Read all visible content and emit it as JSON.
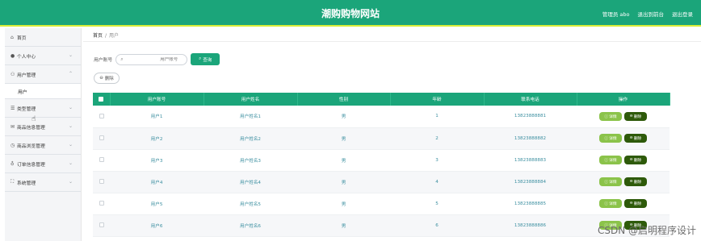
{
  "header": {
    "title": "潮购购物网站",
    "links": [
      "管理员 abo",
      "退出到前台",
      "退出登录"
    ]
  },
  "sidebar": {
    "items": [
      {
        "label": "首页",
        "icon": "home-icon",
        "glyph": "⌂",
        "chevron": false
      },
      {
        "label": "个人中心",
        "icon": "user-icon",
        "glyph": "●",
        "chevron": true
      },
      {
        "label": "用户管理",
        "icon": "users-icon",
        "glyph": "⚇",
        "chevron": true
      },
      {
        "label": "类型管理",
        "icon": "list-icon",
        "glyph": "☰",
        "chevron": true
      },
      {
        "label": "商品信息管理",
        "icon": "mail-icon",
        "glyph": "✉",
        "chevron": true
      },
      {
        "label": "商品浏览管理",
        "icon": "clock-icon",
        "glyph": "◷",
        "chevron": true
      },
      {
        "label": "订单信息管理",
        "icon": "bulb-icon",
        "glyph": "♁",
        "chevron": true
      },
      {
        "label": "系统管理",
        "icon": "expand-icon",
        "glyph": "⛶",
        "chevron": true
      }
    ],
    "sub_item": "用户"
  },
  "breadcrumb": {
    "home": "首页",
    "sep": "/",
    "current": "用户"
  },
  "search": {
    "label": "用户账号",
    "placeholder": "用户账号",
    "button": "查询"
  },
  "delete_button": "删除",
  "table": {
    "columns": [
      "用户账号",
      "用户姓名",
      "性别",
      "年龄",
      "联系电话",
      "操作"
    ],
    "rows": [
      [
        "用户1",
        "用户姓名1",
        "男",
        "1",
        "13823888881"
      ],
      [
        "用户2",
        "用户姓名2",
        "男",
        "2",
        "13823888882"
      ],
      [
        "用户3",
        "用户姓名3",
        "男",
        "3",
        "13823888883"
      ],
      [
        "用户4",
        "用户姓名4",
        "男",
        "4",
        "13823888884"
      ],
      [
        "用户5",
        "用户姓名5",
        "男",
        "5",
        "13823888885"
      ],
      [
        "用户6",
        "用户姓名6",
        "男",
        "6",
        "13823888886"
      ]
    ],
    "action_view": "详情",
    "action_delete": "删除"
  },
  "watermark": "CSDN @启明程序设计",
  "colors": {
    "primary": "#1ba57a",
    "accent_line": "#d9ed38",
    "view_button": "#8bc34a",
    "delete_button": "#2e5a0a"
  }
}
